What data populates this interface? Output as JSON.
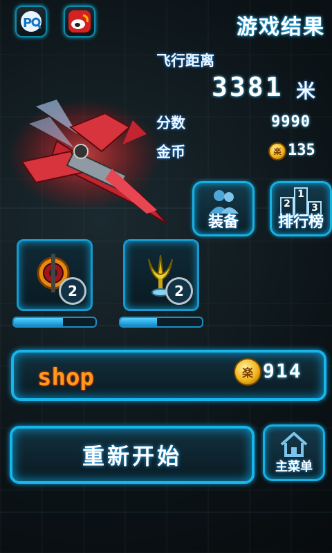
{
  "header": {
    "title": "游戏结果",
    "left_icon_1": "pq-logo-icon",
    "left_icon_2": "weibo-icon"
  },
  "stats": {
    "distance_label": "飞行距离",
    "distance_value": "3381",
    "distance_unit": "米",
    "score_label": "分数",
    "score_value": "9990",
    "coins_label": "金币",
    "coins_value": "135"
  },
  "buttons": {
    "equip": "装备",
    "leaderboard": "排行榜",
    "leaderboard_ranks": [
      "1",
      "2",
      "3"
    ],
    "shop": "shop",
    "shop_coins": "914",
    "restart": "重新开始",
    "main_menu": "主菜单"
  },
  "items": [
    {
      "icon": "bomb-icon",
      "count": "2",
      "progress": 0.6
    },
    {
      "icon": "trident-icon",
      "count": "2",
      "progress": 0.45
    }
  ],
  "coin_symbol": "楽",
  "colors": {
    "accent_border": "#17b5ea",
    "shop_text": "#ff9a1c",
    "coin_gold": "#f2b51c"
  }
}
